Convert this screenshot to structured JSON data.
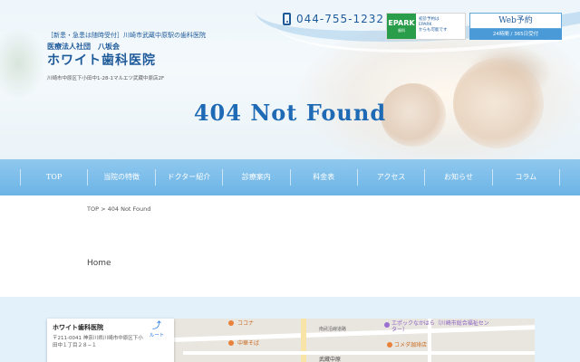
{
  "header": {
    "tagline": "［新患・急患は随時受付］川崎市武蔵中原駅の歯科医院",
    "corp_name": "医療法人社団　八坂会",
    "clinic_name": "ホワイト歯科医院",
    "address": "川崎市中原区下小田中1-28-1マルエツ武蔵中原店2F",
    "phone": "044-755-1232",
    "epark": {
      "badge": "EPARK",
      "badge_sub": "歯科",
      "line1": "初診予約は",
      "line2": "EPARK",
      "line3": "からも可能です"
    },
    "web_reservation": {
      "label": "Web予約",
      "sub": "24時間 / 365日受付"
    }
  },
  "page_title": "404 Not Found",
  "nav": {
    "items": [
      {
        "label": "TOP"
      },
      {
        "label": "当院の特徴"
      },
      {
        "label": "ドクター紹介"
      },
      {
        "label": "診療案内"
      },
      {
        "label": "料金表"
      },
      {
        "label": "アクセス"
      },
      {
        "label": "お知らせ"
      },
      {
        "label": "コラム"
      }
    ]
  },
  "breadcrumb": {
    "home": "TOP",
    "separator": " > ",
    "current": "404 Not Found"
  },
  "content": {
    "home_link": "Home"
  },
  "map": {
    "info_name": "ホワイト歯科医院",
    "info_address": "〒211-0041 神奈川県川崎市中原区下小田中１丁目２８−１",
    "route_label": "ルート",
    "labels": {
      "coconut": "ココナ",
      "chinese": "中華そば",
      "road": "南武沿線道路",
      "epochs": "エポックなかはら（川崎市総合福祉センター）",
      "komeda": "コメダ珈琲店",
      "musashi": "武蔵中原"
    }
  },
  "colors": {
    "brand_blue": "#1e5a9a",
    "title_blue": "#1f6ab5",
    "nav_blue": "#6cb4e6",
    "epark_green": "#2a9d4a"
  }
}
